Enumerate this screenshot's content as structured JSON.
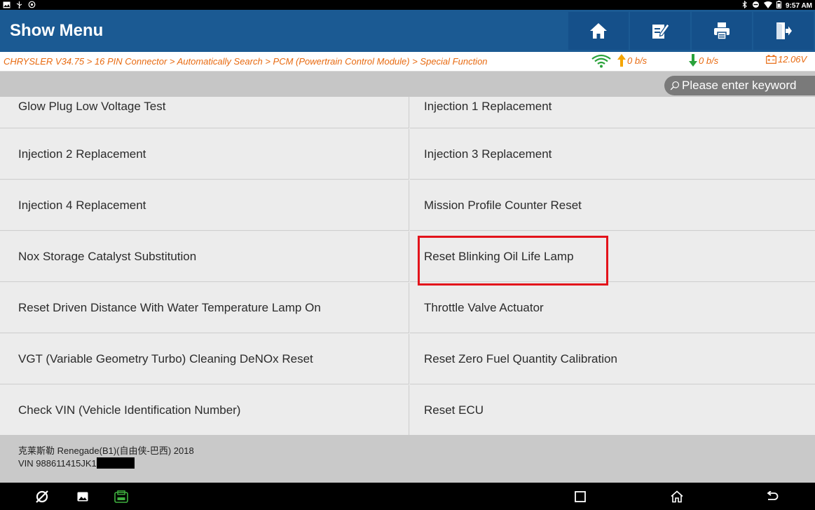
{
  "status_bar": {
    "left_icons": [
      "image-icon",
      "usb-icon",
      "settings-icon"
    ],
    "right_icons": [
      "bluetooth-icon",
      "dnd-icon",
      "wifi-icon",
      "battery-icon"
    ],
    "time": "9:57 AM"
  },
  "header": {
    "title": "Show Menu",
    "buttons": [
      "home-icon",
      "edit-icon",
      "print-icon",
      "exit-icon"
    ]
  },
  "breadcrumb": {
    "text": "CHRYSLER V34.75 > 16 PIN Connector > Automatically Search > PCM (Powertrain Control Module) > Special Function",
    "upload": "0 b/s",
    "download": "0 b/s",
    "voltage": "12.06V"
  },
  "search": {
    "placeholder": "Please enter keyword"
  },
  "menu": {
    "rows": [
      {
        "left": "Glow Plug Low Voltage Test",
        "right": "Injection 1 Replacement"
      },
      {
        "left": "Injection 2 Replacement",
        "right": "Injection 3 Replacement"
      },
      {
        "left": "Injection 4 Replacement",
        "right": "Mission Profile Counter Reset"
      },
      {
        "left": "Nox Storage Catalyst Substitution",
        "right": "Reset Blinking Oil Life Lamp"
      },
      {
        "left": "Reset Driven Distance With Water Temperature Lamp On",
        "right": "Throttle Valve Actuator"
      },
      {
        "left": "VGT (Variable Geometry Turbo) Cleaning DeNOx Reset",
        "right": "Reset Zero Fuel Quantity Calibration"
      },
      {
        "left": "Check VIN (Vehicle Identification Number)",
        "right": "Reset ECU"
      }
    ],
    "highlighted_item": "Reset Blinking Oil Life Lamp"
  },
  "vehicle": {
    "model": "克莱斯勒 Renegade(B1)(自由侠-巴西) 2018",
    "vin": "VIN 988611415JK1"
  },
  "navigation": [
    "browser-icon",
    "gallery-icon",
    "vci-icon",
    "recents-icon",
    "home-icon",
    "back-icon"
  ],
  "colors": {
    "header_bg": "#1b5a93",
    "breadcrumb_text": "#e86a10",
    "highlight_border": "#e3131b",
    "upload_arrow": "#f5a500",
    "download_arrow": "#2aa23a",
    "vci_icon": "#3fb13f"
  }
}
